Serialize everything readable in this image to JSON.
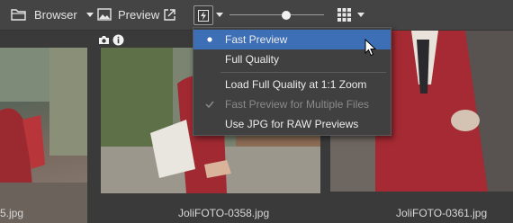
{
  "toolbar": {
    "browser_label": "Browser",
    "preview_label": "Preview",
    "icons": {
      "browser": "folder-icon",
      "preview": "image-icon",
      "external": "external-link-icon",
      "flash": "lightning-icon",
      "grid": "grid-icon"
    },
    "slider_value": 0.6
  },
  "menu": {
    "items": [
      {
        "label": "Fast Preview",
        "selected": true,
        "mark": "dot"
      },
      {
        "label": "Full Quality"
      },
      {
        "label": "Load Full Quality at 1:1 Zoom"
      },
      {
        "label": "Fast Preview for Multiple Files",
        "disabled": true,
        "mark": "check"
      },
      {
        "label": "Use JPG for RAW Previews"
      }
    ]
  },
  "thumbnails": [
    {
      "label": "5.jpg"
    },
    {
      "label": "JoliFOTO-0358.jpg"
    },
    {
      "label": "JoliFOTO-0361.jpg"
    }
  ],
  "colors": {
    "toolbar_bg": "#444444",
    "content_bg": "#3a3a3a",
    "menu_bg": "#404040",
    "menu_selected": "#3d6fb6"
  }
}
